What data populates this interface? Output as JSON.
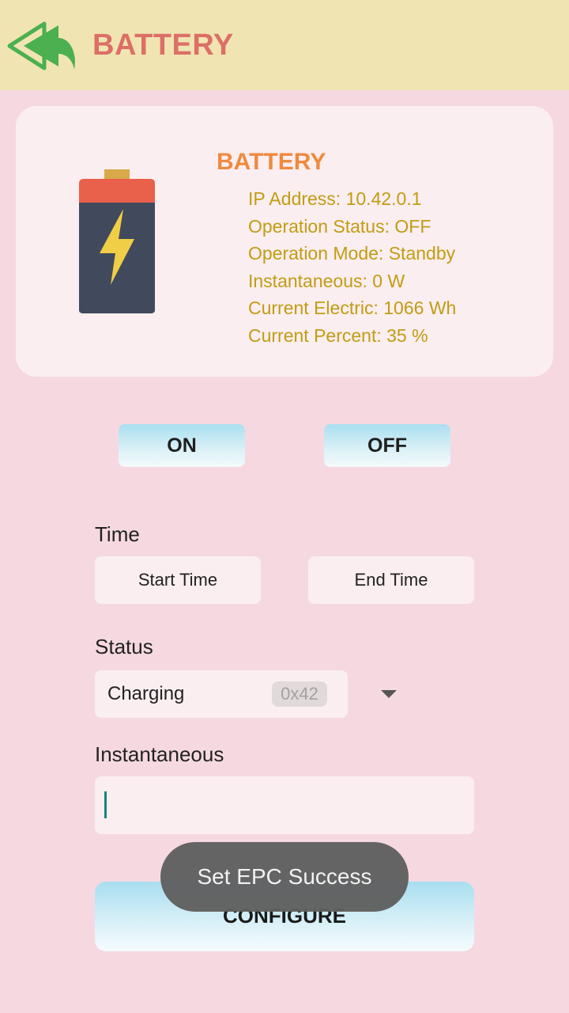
{
  "appbar": {
    "title": "BATTERY",
    "back_icon": "double-back-arrow-icon",
    "back_icon_color": "#4caf50",
    "title_color": "#dc6f67",
    "background": "#f0e5b2"
  },
  "device_card": {
    "title": "BATTERY",
    "icon": "battery-icon",
    "info": [
      "IP Address: 10.42.0.1",
      "Operation Status: OFF",
      "Operation Mode: Standby",
      "Instantaneous: 0 W",
      "Current Electric: 1066 Wh",
      "Current Percent: 35 %"
    ]
  },
  "power_buttons": {
    "on": "ON",
    "off": "OFF"
  },
  "time_section": {
    "label": "Time",
    "start": "Start Time",
    "end": "End Time"
  },
  "status_section": {
    "label": "Status",
    "selected": "Charging",
    "code": "0x42"
  },
  "instantaneous_section": {
    "label": "Instantaneous",
    "value": ""
  },
  "configure_button": {
    "label": "CONFIGURE"
  },
  "toast": {
    "message": "Set EPC Success"
  }
}
